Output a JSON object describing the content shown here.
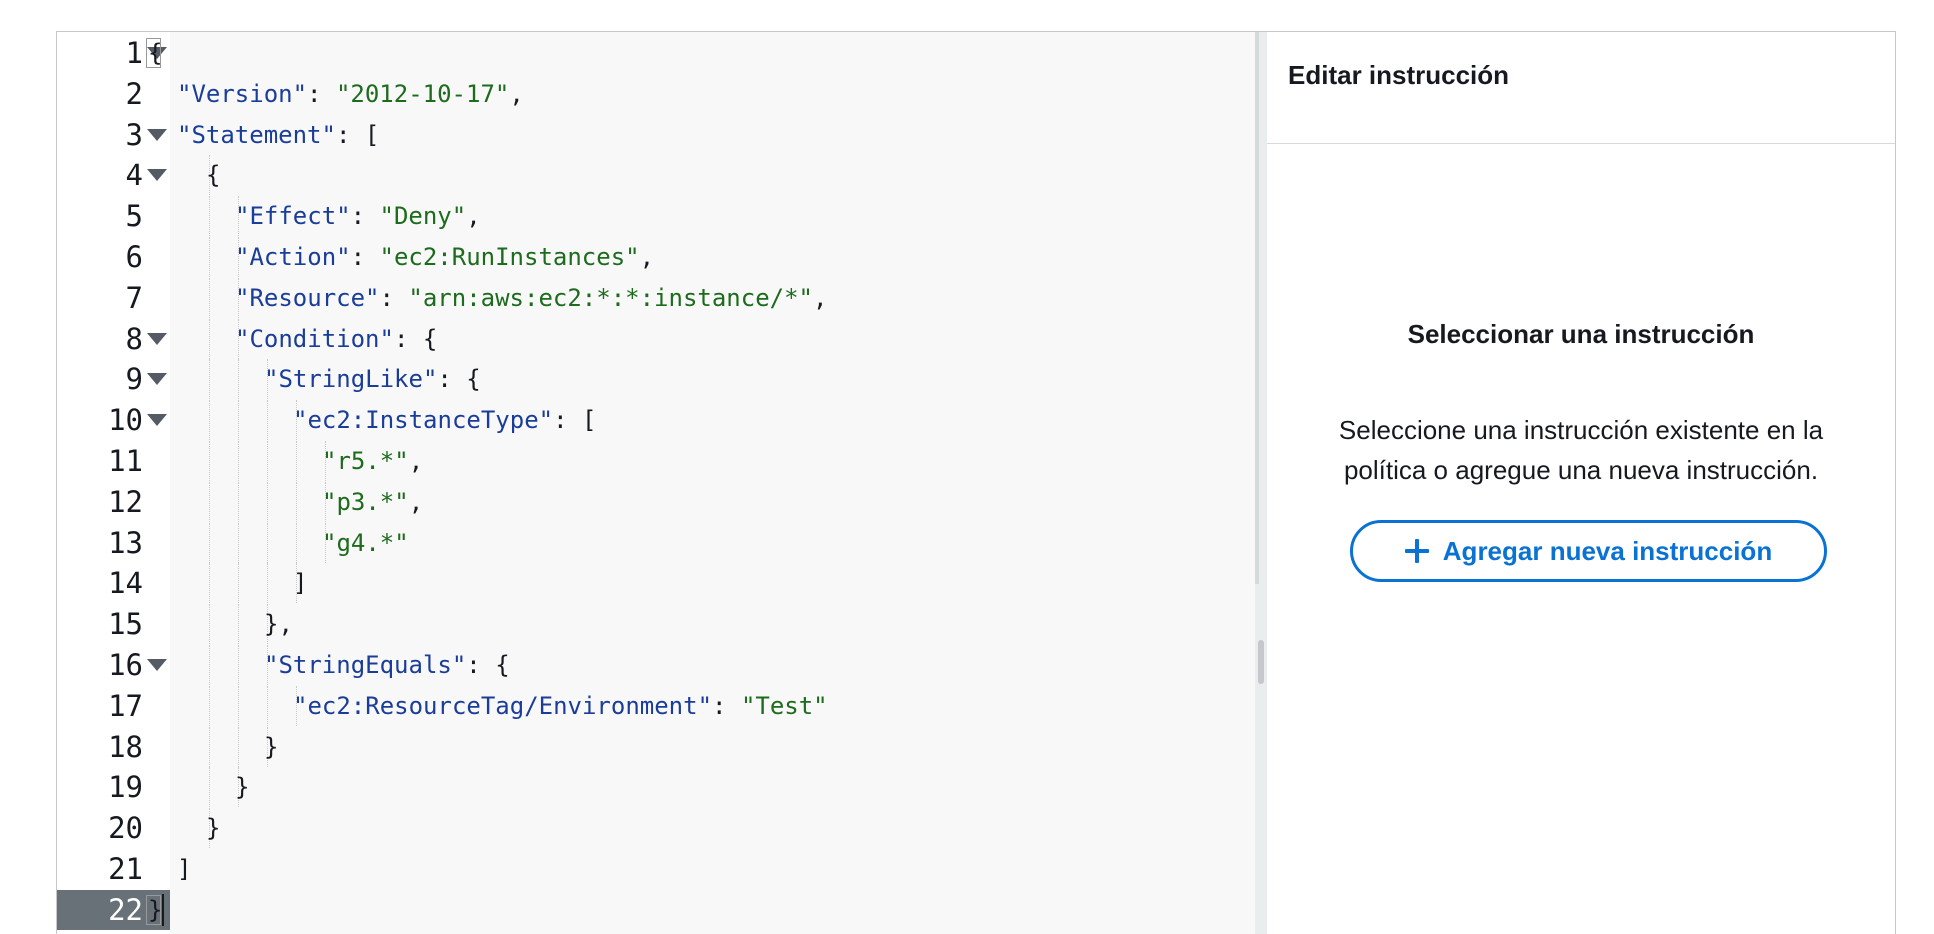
{
  "editor": {
    "lines": [
      {
        "num": "1",
        "fold": true,
        "indent": 0,
        "tokens": [
          [
            "p",
            "{"
          ]
        ],
        "bracket_open": true
      },
      {
        "num": "2",
        "fold": false,
        "indent": 1,
        "tokens": [
          [
            "k",
            "\"Version\""
          ],
          [
            "p",
            ": "
          ],
          [
            "s",
            "\"2012-10-17\""
          ],
          [
            "p",
            ","
          ]
        ]
      },
      {
        "num": "3",
        "fold": true,
        "indent": 1,
        "tokens": [
          [
            "k",
            "\"Statement\""
          ],
          [
            "p",
            ": ["
          ]
        ]
      },
      {
        "num": "4",
        "fold": true,
        "indent": 2,
        "tokens": [
          [
            "p",
            "{"
          ]
        ]
      },
      {
        "num": "5",
        "fold": false,
        "indent": 3,
        "tokens": [
          [
            "k",
            "\"Effect\""
          ],
          [
            "p",
            ": "
          ],
          [
            "s",
            "\"Deny\""
          ],
          [
            "p",
            ","
          ]
        ]
      },
      {
        "num": "6",
        "fold": false,
        "indent": 3,
        "tokens": [
          [
            "k",
            "\"Action\""
          ],
          [
            "p",
            ": "
          ],
          [
            "s",
            "\"ec2:RunInstances\""
          ],
          [
            "p",
            ","
          ]
        ]
      },
      {
        "num": "7",
        "fold": false,
        "indent": 3,
        "tokens": [
          [
            "k",
            "\"Resource\""
          ],
          [
            "p",
            ": "
          ],
          [
            "s",
            "\"arn:aws:ec2:*:*:instance/*\""
          ],
          [
            "p",
            ","
          ]
        ]
      },
      {
        "num": "8",
        "fold": true,
        "indent": 3,
        "tokens": [
          [
            "k",
            "\"Condition\""
          ],
          [
            "p",
            ": {"
          ]
        ]
      },
      {
        "num": "9",
        "fold": true,
        "indent": 4,
        "tokens": [
          [
            "k",
            "\"StringLike\""
          ],
          [
            "p",
            ": {"
          ]
        ]
      },
      {
        "num": "10",
        "fold": true,
        "indent": 5,
        "tokens": [
          [
            "k",
            "\"ec2:InstanceType\""
          ],
          [
            "p",
            ": ["
          ]
        ]
      },
      {
        "num": "11",
        "fold": false,
        "indent": 6,
        "tokens": [
          [
            "s",
            "\"r5.*\""
          ],
          [
            "p",
            ","
          ]
        ]
      },
      {
        "num": "12",
        "fold": false,
        "indent": 6,
        "tokens": [
          [
            "s",
            "\"p3.*\""
          ],
          [
            "p",
            ","
          ]
        ]
      },
      {
        "num": "13",
        "fold": false,
        "indent": 6,
        "tokens": [
          [
            "s",
            "\"g4.*\""
          ]
        ]
      },
      {
        "num": "14",
        "fold": false,
        "indent": 5,
        "tokens": [
          [
            "p",
            "]"
          ]
        ]
      },
      {
        "num": "15",
        "fold": false,
        "indent": 4,
        "tokens": [
          [
            "p",
            "},"
          ]
        ]
      },
      {
        "num": "16",
        "fold": true,
        "indent": 4,
        "tokens": [
          [
            "k",
            "\"StringEquals\""
          ],
          [
            "p",
            ": {"
          ]
        ]
      },
      {
        "num": "17",
        "fold": false,
        "indent": 5,
        "tokens": [
          [
            "k",
            "\"ec2:ResourceTag/Environment\""
          ],
          [
            "p",
            ": "
          ],
          [
            "s",
            "\"Test\""
          ]
        ]
      },
      {
        "num": "18",
        "fold": false,
        "indent": 4,
        "tokens": [
          [
            "p",
            "}"
          ]
        ]
      },
      {
        "num": "19",
        "fold": false,
        "indent": 3,
        "tokens": [
          [
            "p",
            "}"
          ]
        ]
      },
      {
        "num": "20",
        "fold": false,
        "indent": 2,
        "tokens": [
          [
            "p",
            "}"
          ]
        ]
      },
      {
        "num": "21",
        "fold": false,
        "indent": 1,
        "tokens": [
          [
            "p",
            "]"
          ]
        ]
      },
      {
        "num": "22",
        "fold": false,
        "indent": 0,
        "tokens": [
          [
            "p",
            "}"
          ]
        ],
        "active": true,
        "bracket_close": true
      }
    ]
  },
  "panel": {
    "title": "Editar instrucción",
    "empty_title": "Seleccionar una instrucción",
    "empty_description": "Seleccione una instrucción existente en la política o agregue una nueva instrucción.",
    "add_button_label": "Agregar nueva instrucción",
    "add_button_icon": "plus-icon"
  },
  "colors": {
    "accent": "#0972d3",
    "json_key": "#1a3d99",
    "json_string": "#1d6b1d",
    "active_gutter": "#687078"
  }
}
